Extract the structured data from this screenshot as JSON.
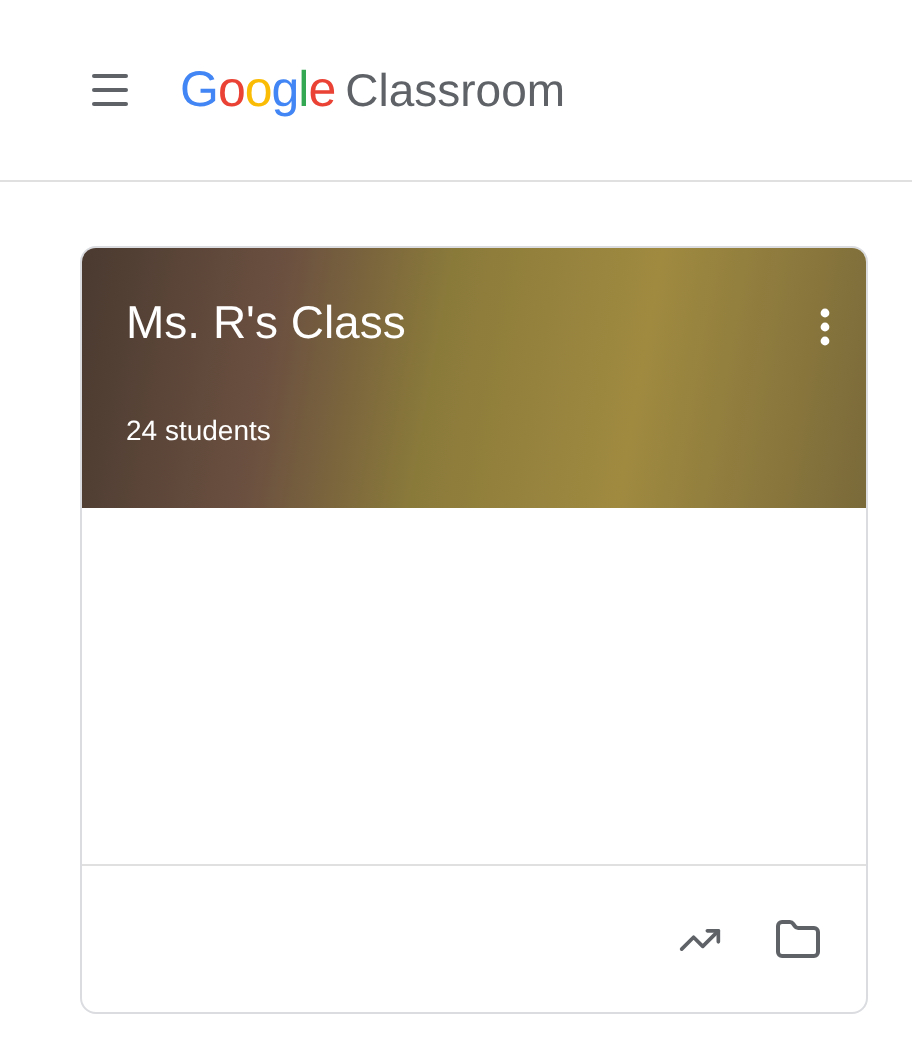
{
  "header": {
    "logo": "Google",
    "product": "Classroom"
  },
  "class_card": {
    "title": "Ms. R's Class",
    "subtitle": "24 students"
  }
}
